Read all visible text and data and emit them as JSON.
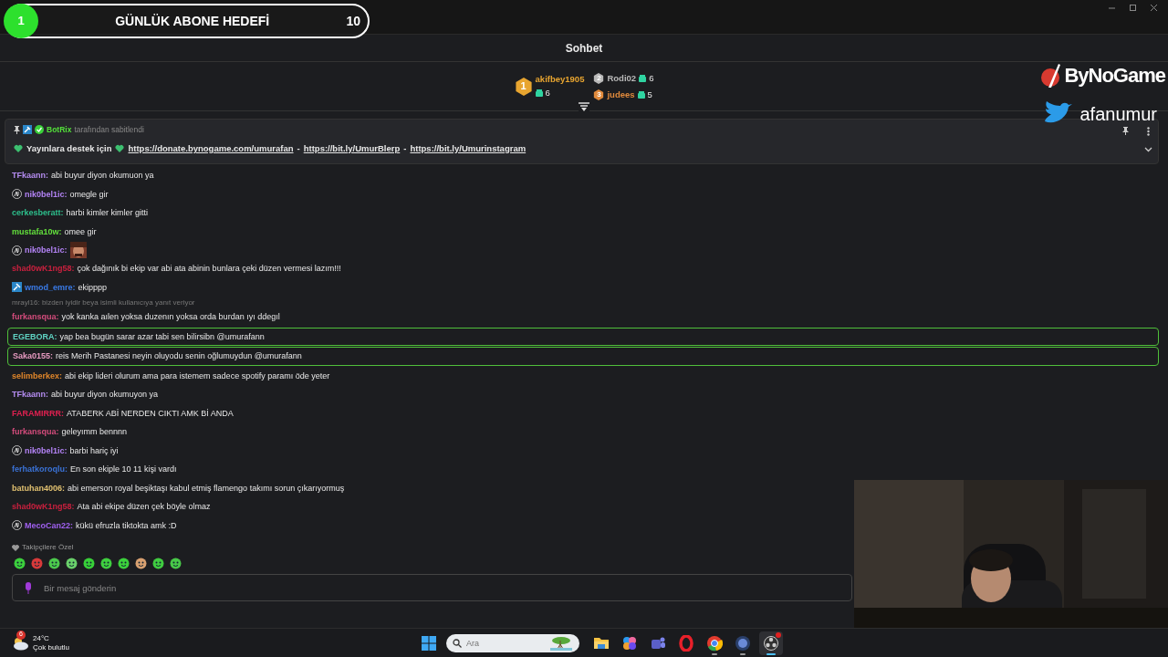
{
  "goal": {
    "number": "1",
    "title": "GÜNLÜK ABONE HEDEFİ",
    "count": "10"
  },
  "window_controls": [
    {
      "kind": "minimize"
    },
    {
      "kind": "maximize"
    },
    {
      "kind": "close"
    }
  ],
  "chat_header": {
    "title": "Sohbet"
  },
  "top_gifters": [
    {
      "rank": "1",
      "name": "akifbey1905",
      "count": "6",
      "color": "#e8a530"
    },
    {
      "rank": "2",
      "name": "Rodi02",
      "count": "6",
      "color": "#b9b9b9"
    },
    {
      "rank": "3",
      "name": "judees",
      "count": "5",
      "color": "#e08a3c"
    }
  ],
  "pinned": {
    "author": "BotRix",
    "note": "tarafından sabitlendi",
    "parts": [
      {
        "kind": "heart"
      },
      {
        "kind": "text",
        "text": "Yayınlara destek için"
      },
      {
        "kind": "heart"
      },
      {
        "kind": "link",
        "text": "https://donate.bynogame.com/umurafan"
      },
      {
        "kind": "text",
        "text": "-"
      },
      {
        "kind": "link",
        "text": "https://bit.ly/UmurBlerp"
      },
      {
        "kind": "text",
        "text": "-"
      },
      {
        "kind": "link",
        "text": "https://bit.ly/Umurinstagram"
      }
    ]
  },
  "messages": [
    {
      "user": "TFkaann:",
      "color": "#b48cf0",
      "kind": "plain",
      "text": "abi buyur diyon okumuon ya",
      "highlighted": false
    },
    {
      "user": "nik0bel1ic:",
      "color": "#b383f5",
      "kind": "ai",
      "text": "omegle gir",
      "highlighted": false
    },
    {
      "user": "cerkesberatt:",
      "color": "#2dbf8c",
      "kind": "plain",
      "text": "harbi kimler kimler gitti",
      "highlighted": false
    },
    {
      "user": "mustafa10w:",
      "color": "#63e03c",
      "kind": "plain",
      "text": "omee gir",
      "highlighted": false
    },
    {
      "user": "nik0bel1ic:",
      "color": "#b383f5",
      "kind": "ai",
      "emote": true,
      "highlighted": false
    },
    {
      "user": "shad0wK1ng58:",
      "color": "#c9203e",
      "kind": "plain",
      "text": "çok dağınık bi ekip var abi ata abinin bunlara çeki düzen vermesi lazım!!!",
      "highlighted": false
    },
    {
      "user": "wmod_emre:",
      "color": "#3a7be8",
      "kind": "mod",
      "text": "ekipppp",
      "highlighted": false
    },
    {
      "user": "furkansqua:",
      "color": "#d44c7c",
      "kind": "plain",
      "reply": "mrayl16: bizden iyidir beya isimli kullanıcıya yanıt veriyor",
      "text": "yok kanka aılen yoksa duzenın yoksa orda burdan ıyı ddegıl",
      "highlighted": false
    },
    {
      "user": "EGEBORA:",
      "color": "#5fd3c3",
      "kind": "plain",
      "text": "yap bea bugün sarar azar tabi sen bilirsibn @umurafann",
      "highlighted": true
    },
    {
      "user": "Saka0155:",
      "color": "#e79ac0",
      "kind": "plain",
      "text": "reis Merih Pastanesi neyin oluyodu senin oğlumuydun @umurafann",
      "highlighted": true
    },
    {
      "user": "selimberkex:",
      "color": "#e0862a",
      "kind": "plain",
      "text": "abi ekip lideri olurum ama para istemem sadece spotify paramı öde yeter",
      "highlighted": false
    },
    {
      "user": "TFkaann:",
      "color": "#b48cf0",
      "kind": "plain",
      "text": "abi buyur diyon okumuyon ya",
      "highlighted": false
    },
    {
      "user": "FARAMIRRR:",
      "color": "#e02050",
      "kind": "plain",
      "text": "ATABERK ABİ NERDEN CIKTI AMK Bİ ANDA",
      "highlighted": false
    },
    {
      "user": "furkansqua:",
      "color": "#d44c7c",
      "kind": "plain",
      "text": "geleyımm bennnn",
      "highlighted": false
    },
    {
      "user": "nik0bel1ic:",
      "color": "#b383f5",
      "kind": "ai",
      "text": "barbi hariç iyi",
      "highlighted": false
    },
    {
      "user": "ferhatkoroqlu:",
      "color": "#3a72d6",
      "kind": "plain",
      "text": "En son ekiple 10 11 kişi vardı",
      "highlighted": false
    },
    {
      "user": "batuhan4006:",
      "color": "#e0c070",
      "kind": "plain",
      "text": "abi emerson royal beşiktaşı kabul etmiş flamengo takımı sorun çıkarıyormuş",
      "highlighted": false
    },
    {
      "user": "shad0wK1ng58:",
      "color": "#c9203e",
      "kind": "plain",
      "text": "Ata abi ekipe düzen çek böyle olmaz",
      "highlighted": false
    },
    {
      "user": "MecoCan22:",
      "color": "#a060f0",
      "kind": "ai",
      "text": "kükü efruzla tiktokta amk :D",
      "highlighted": false
    }
  ],
  "emote_section": {
    "title": "Takipçilere Özel",
    "emotes": [
      {
        "color": "#3ccf3c"
      },
      {
        "color": "#d83a3a"
      },
      {
        "color": "#4cc94c"
      },
      {
        "color": "#6ad06a"
      },
      {
        "color": "#38d038"
      },
      {
        "color": "#3fcf3f"
      },
      {
        "color": "#3cd13c"
      },
      {
        "color": "#d8a070"
      },
      {
        "color": "#40cc40"
      },
      {
        "color": "#48c848"
      }
    ]
  },
  "chat_input": {
    "placeholder": "Bir mesaj gönderin"
  },
  "overlay": {
    "brand": "ByNoGame",
    "handle": "afanumur"
  },
  "taskbar": {
    "weather": {
      "badge": "6",
      "temperature": "24°C",
      "condition": "Çok bulutlu"
    },
    "search": {
      "placeholder": "Ara"
    },
    "apps": [
      {
        "kind": "folder",
        "running": false,
        "selected": false
      },
      {
        "kind": "clover",
        "running": false,
        "selected": false
      },
      {
        "kind": "people",
        "running": false,
        "selected": false
      },
      {
        "kind": "ring",
        "running": false,
        "selected": false
      },
      {
        "kind": "wheel",
        "running": true,
        "selected": false
      },
      {
        "kind": "disc",
        "running": true,
        "selected": false
      },
      {
        "kind": "dots",
        "running": true,
        "selected": true,
        "notification": true
      }
    ]
  }
}
